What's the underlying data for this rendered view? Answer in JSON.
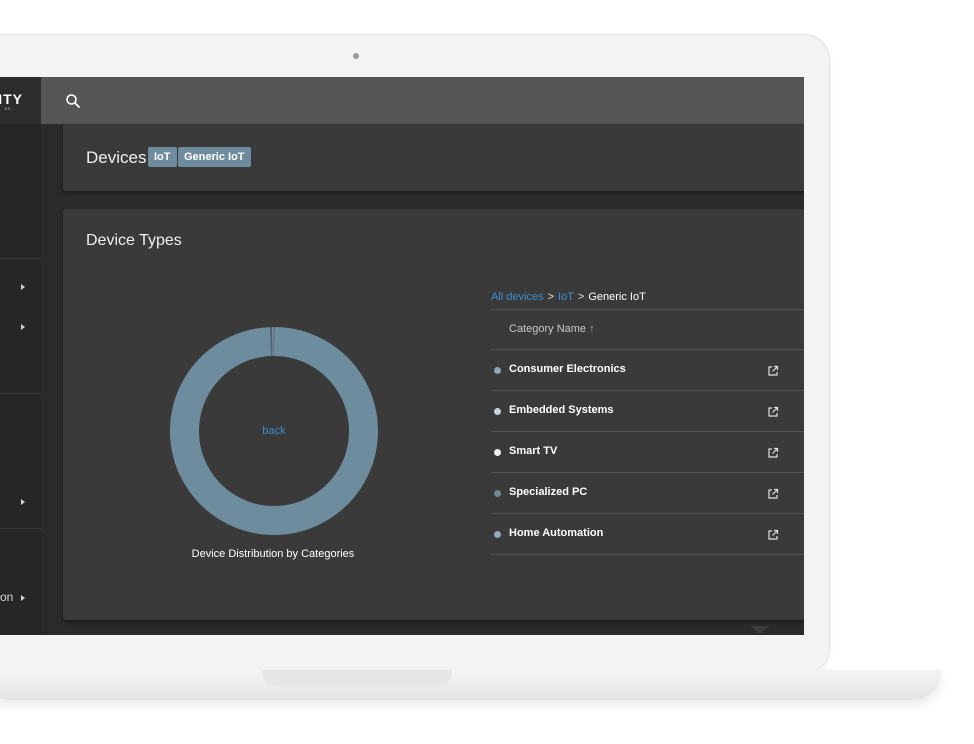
{
  "app": {
    "logo_text": "ITY",
    "logo_sub": "KS"
  },
  "sidebar": {
    "items": [
      {
        "label": ""
      },
      {
        "label": ""
      },
      {
        "label": ""
      },
      {
        "label": "on"
      }
    ]
  },
  "header": {
    "title": "Devices",
    "tags": [
      "IoT",
      "Generic IoT"
    ]
  },
  "device_types": {
    "title": "Device Types",
    "chart_center_link": "back",
    "chart_caption": "Device Distribution by Categories",
    "breadcrumb": {
      "root": "All devices",
      "separator": ">",
      "parent": "IoT",
      "current": "Generic IoT"
    },
    "table": {
      "column_header": "Category Name",
      "sort_icon": "arrow-up-icon",
      "rows": [
        {
          "label": "Consumer Electronics",
          "dot_color": "#8aa7b8"
        },
        {
          "label": "Embedded Systems",
          "dot_color": "#c6d4dc"
        },
        {
          "label": "Smart TV",
          "dot_color": "#f2f2f2"
        },
        {
          "label": "Specialized PC",
          "dot_color": "#6e8794"
        },
        {
          "label": "Home Automation",
          "dot_color": "#93aab8"
        }
      ]
    }
  },
  "colors": {
    "accent": "#3b8fd4",
    "tag_bg": "#6f8c9e",
    "donut": "#6d8c9e"
  },
  "chart_data": {
    "type": "pie",
    "donut": true,
    "title": "Device Distribution by Categories",
    "categories": [
      "Consumer Electronics",
      "Embedded Systems",
      "Smart TV",
      "Specialized PC",
      "Home Automation"
    ],
    "values": [
      99.2,
      0.3,
      0.2,
      0.2,
      0.1
    ]
  }
}
